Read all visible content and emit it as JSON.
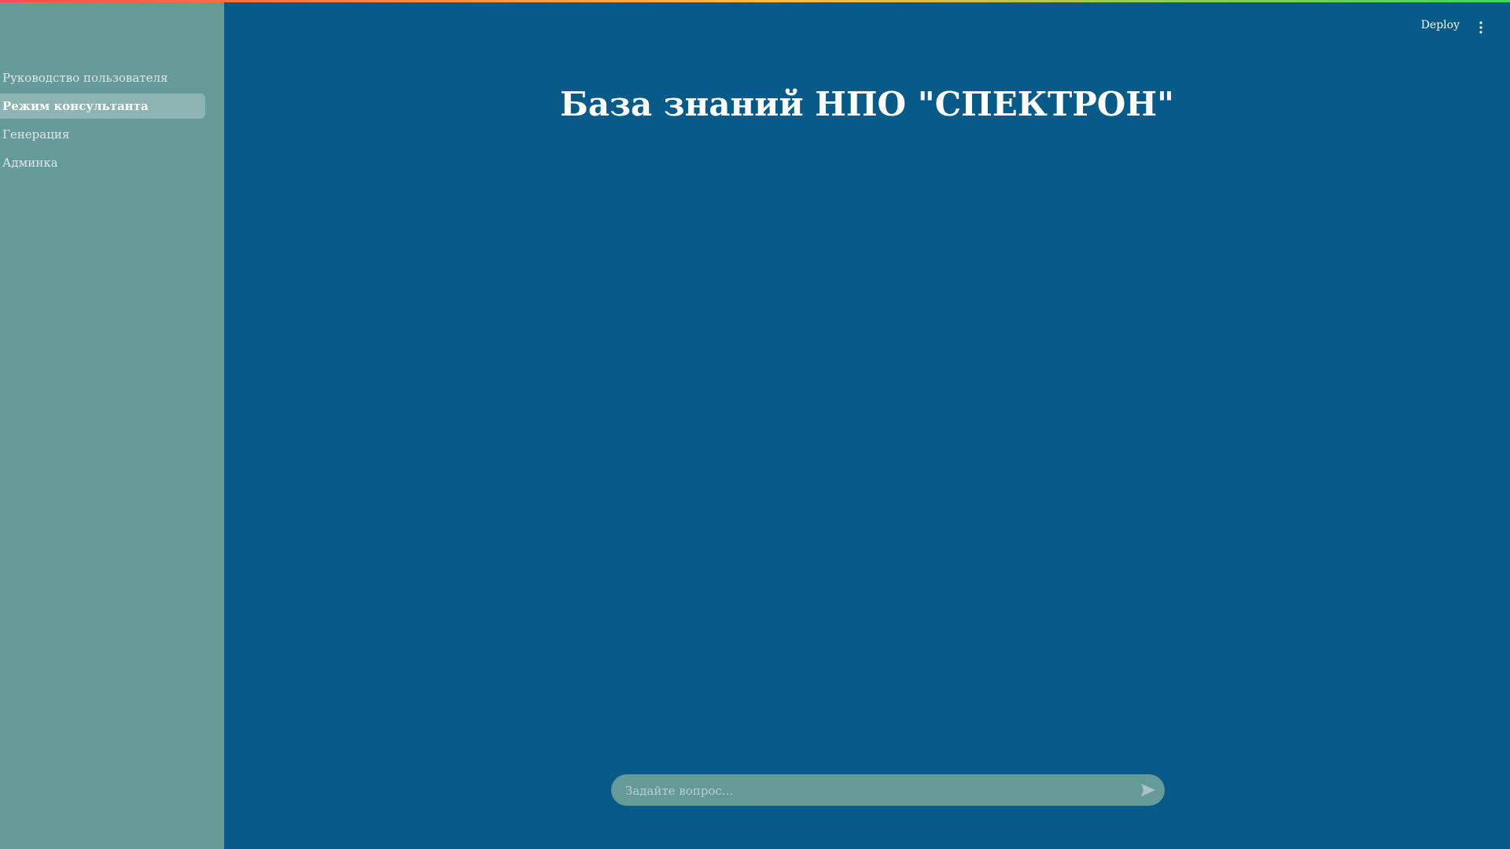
{
  "sidebar": {
    "items": [
      {
        "label": "Руководство пользователя",
        "active": false
      },
      {
        "label": "Режим консультанта",
        "active": true
      },
      {
        "label": "Генерация",
        "active": false
      },
      {
        "label": "Админка",
        "active": false
      }
    ]
  },
  "header": {
    "deploy_label": "Deploy",
    "menu_icon": "more-vert-icon"
  },
  "main": {
    "title": "База знаний НПО \"СПЕКТРОН\""
  },
  "chat": {
    "placeholder": "Задайте вопрос...",
    "value": "",
    "send_icon": "send-icon"
  },
  "colors": {
    "main_bg": "#085b88",
    "sidebar_bg": "#669a99",
    "active_item_bg": "#8db3b2",
    "input_bg": "#669a99"
  }
}
